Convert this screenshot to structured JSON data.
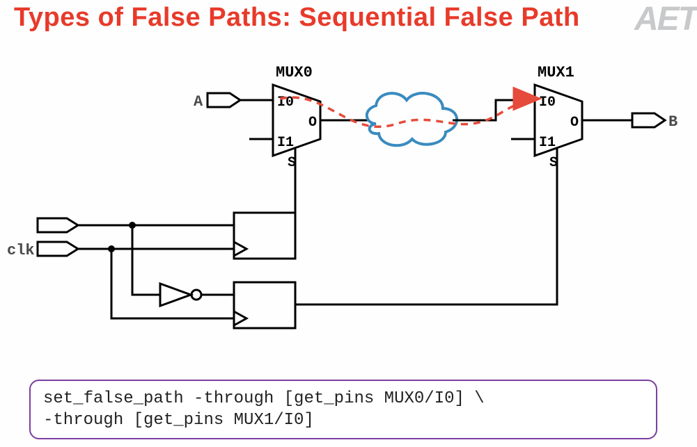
{
  "title": "Types of False Paths: Sequential False Path",
  "title_color": "#e83a2a",
  "watermark": "AET",
  "signals": {
    "A": "A",
    "B": "B",
    "clk": "clk"
  },
  "mux0": {
    "name": "MUX0",
    "i0": "I0",
    "i1": "I1",
    "o": "O",
    "s": "S"
  },
  "mux1": {
    "name": "MUX1",
    "i0": "I0",
    "i1": "I1",
    "o": "O",
    "s": "S"
  },
  "code": {
    "line1": "set_false_path -through [get_pins MUX0/I0] \\",
    "line2": "-through [get_pins MUX1/I0]"
  },
  "colors": {
    "wire": "#000000",
    "false_path": "#e64a3a",
    "cloud": "#3a8bbf",
    "code_border": "#7b3fa0"
  }
}
